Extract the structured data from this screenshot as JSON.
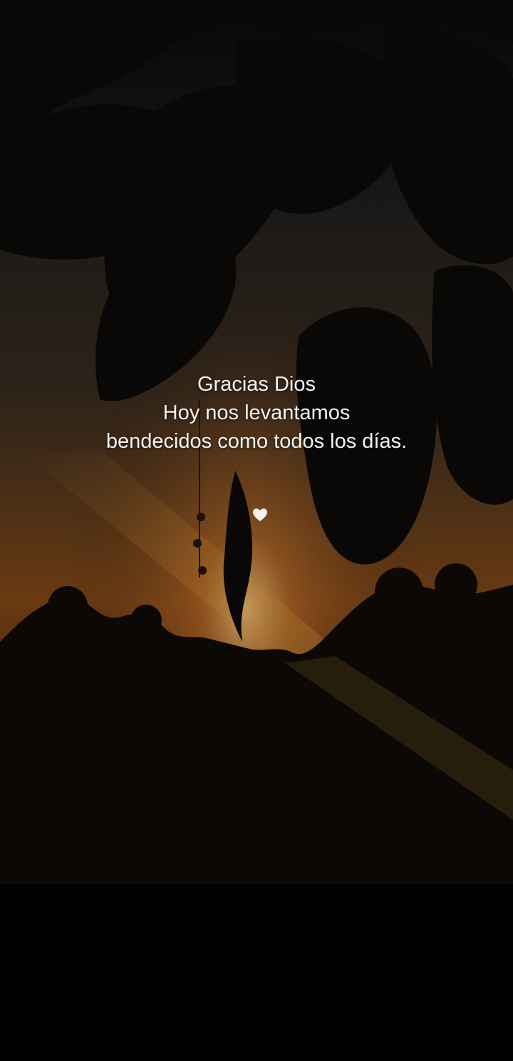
{
  "caption": {
    "line1": "Gracias Dios",
    "line2": "Hoy nos levantamos",
    "line3": "bendecidos como todos los días."
  },
  "icons": {
    "heart": "white-heart-icon"
  },
  "colors": {
    "text": "#f4f4f4",
    "sky_glow": "#8a4a16",
    "silhouette": "#0b0806",
    "background": "#000000"
  }
}
